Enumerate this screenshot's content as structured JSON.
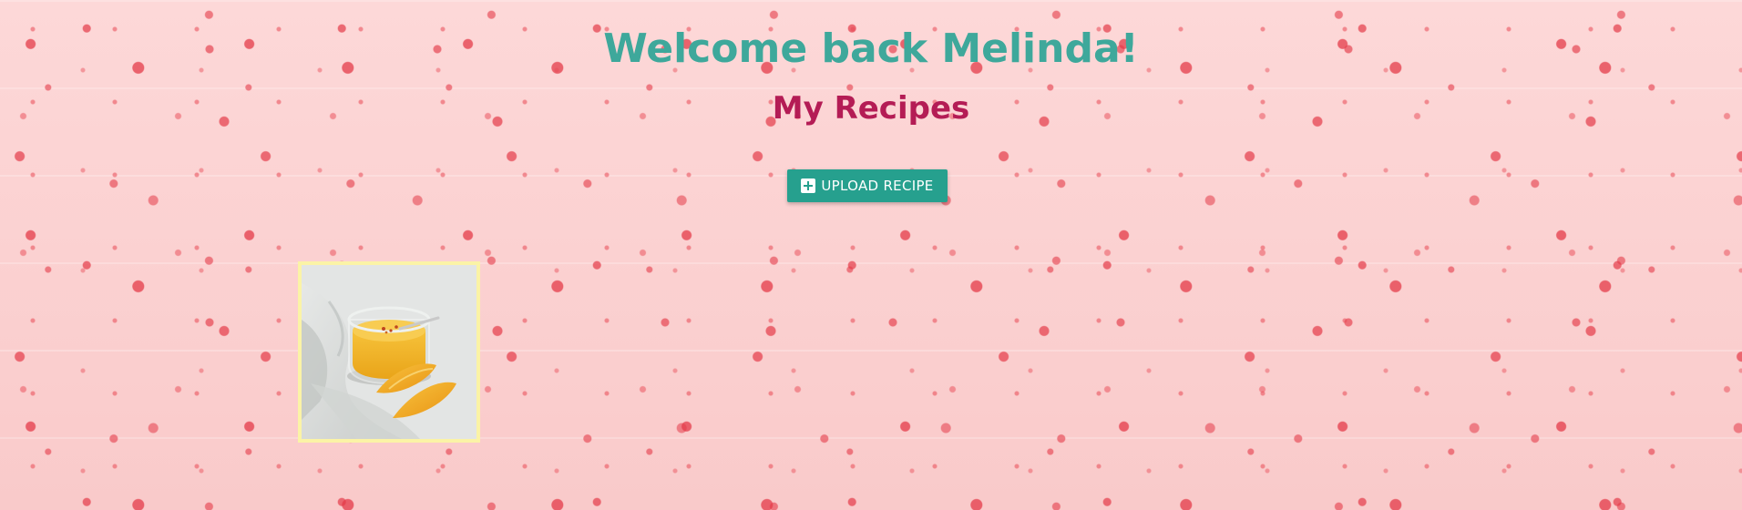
{
  "header": {
    "welcome_text": "Welcome back Melinda!",
    "section_title": "My Recipes"
  },
  "actions": {
    "upload_label": "UPLOAD RECIPE",
    "upload_icon": "plus-square-icon"
  },
  "recipes": [
    {
      "image_subject": "mango pudding in glass jar with mango slices"
    }
  ],
  "colors": {
    "welcome": "#3ea89b",
    "section_title": "#b41c55",
    "button": "#26a08e",
    "card_border": "#fbf3a6"
  }
}
